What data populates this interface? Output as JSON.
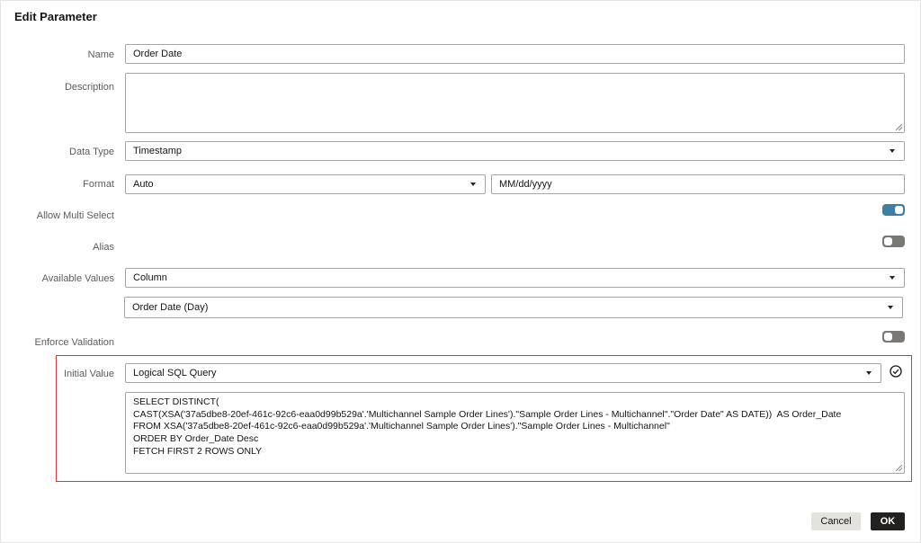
{
  "dialog": {
    "title": "Edit Parameter"
  },
  "fields": {
    "name": {
      "label": "Name",
      "value": "Order Date"
    },
    "description": {
      "label": "Description",
      "value": ""
    },
    "data_type": {
      "label": "Data Type",
      "value": "Timestamp"
    },
    "format": {
      "label": "Format",
      "value": "Auto",
      "pattern": "MM/dd/yyyy"
    },
    "allow_multi_select": {
      "label": "Allow Multi Select",
      "on": true
    },
    "alias": {
      "label": "Alias",
      "on": false
    },
    "available_values": {
      "label": "Available Values",
      "value": "Column",
      "column": "Order Date (Day)"
    },
    "enforce_validation": {
      "label": "Enforce Validation",
      "on": false
    },
    "initial_value": {
      "label": "Initial Value",
      "value": "Logical SQL Query",
      "sql_lines": [
        "SELECT DISTINCT(",
        "CAST(XSA('37a5dbe8-20ef-461c-92c6-eaa0d99b529a'.'Multichannel Sample Order Lines').\"Sample Order Lines - Multichannel\".\"Order Date\" AS DATE))  AS Order_Date",
        "FROM XSA('37a5dbe8-20ef-461c-92c6-eaa0d99b529a'.'Multichannel Sample Order Lines').\"Sample Order Lines - Multichannel\"",
        "ORDER BY Order_Date Desc",
        "FETCH FIRST 2 ROWS ONLY"
      ]
    }
  },
  "buttons": {
    "cancel": "Cancel",
    "ok": "OK"
  },
  "colors": {
    "toggle_on": "#3f7fa4",
    "toggle_off": "#7a7874",
    "highlight_border": "#d9363e",
    "ok_button": "#22211f"
  }
}
